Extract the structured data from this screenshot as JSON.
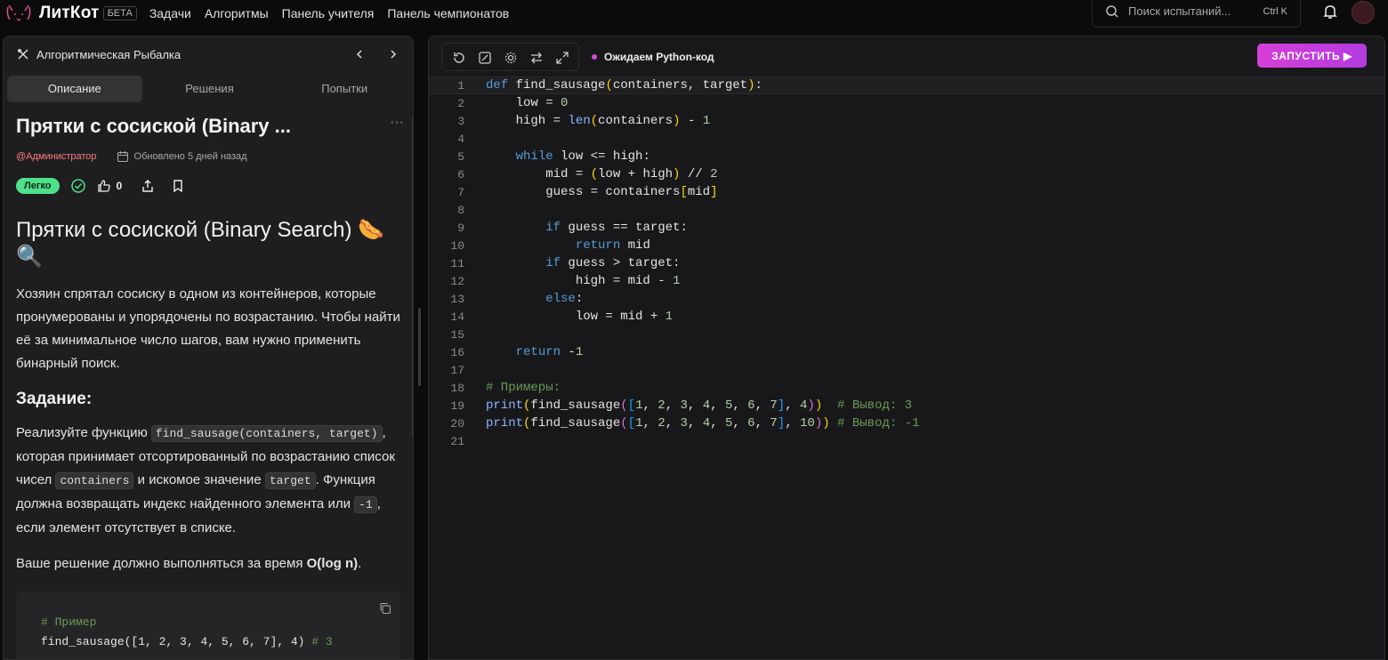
{
  "app": {
    "brand": "ЛитКот",
    "beta": "БЕТА"
  },
  "nav": [
    "Задачи",
    "Алгоритмы",
    "Панель учителя",
    "Панель чемпионатов"
  ],
  "search": {
    "placeholder": "Поиск испытаний...",
    "shortcut": "Ctrl K"
  },
  "left": {
    "section_title": "Алгоритмическая Рыбалка",
    "tabs": [
      "Описание",
      "Решения",
      "Попытки"
    ],
    "problem_title": "Прятки с сосиской (Binary ...",
    "author": "@Администратор",
    "updated": "Обновлено 5 дней назад",
    "difficulty": "Легко",
    "likes": "0",
    "heading": "Прятки с сосиской (Binary Search) 🌭 🔍",
    "intro": "Хозяин спрятал сосиску в одном из контейнеров, которые пронумерованы и упорядочены по возрастанию. Чтобы найти её за минимальное число шагов, вам нужно применить бинарный поиск.",
    "task_heading": "Задание:",
    "task_p1": "Реализуйте функцию",
    "task_code1": "find_sausage(containers, target)",
    "task_p2": ", которая принимает отсортированный по возрастанию список чисел",
    "task_code2": "containers",
    "task_p3": "и искомое значение",
    "task_code3": "target",
    "task_p4": ". Функция должна возвращать индекс найденного элемента или",
    "task_code4": "-1",
    "task_p5": ", если элемент отсутствует в списке.",
    "complexity_p": "Ваше решение должно выполняться за время",
    "complexity": "O(log n)",
    "complexity_end": ".",
    "example_comment": "# Пример",
    "example_code": "find_sausage([1, 2, 3, 4, 5, 6, 7], 4)",
    "example_result": "# 3"
  },
  "editor": {
    "status": "Ожидаем Python-код",
    "run_label": "ЗАПУСТИТЬ ▶",
    "line_numbers": [
      "1",
      "2",
      "3",
      "4",
      "5",
      "6",
      "7",
      "8",
      "9",
      "10",
      "11",
      "12",
      "13",
      "14",
      "15",
      "16",
      "17",
      "18",
      "19",
      "20",
      "21"
    ]
  }
}
